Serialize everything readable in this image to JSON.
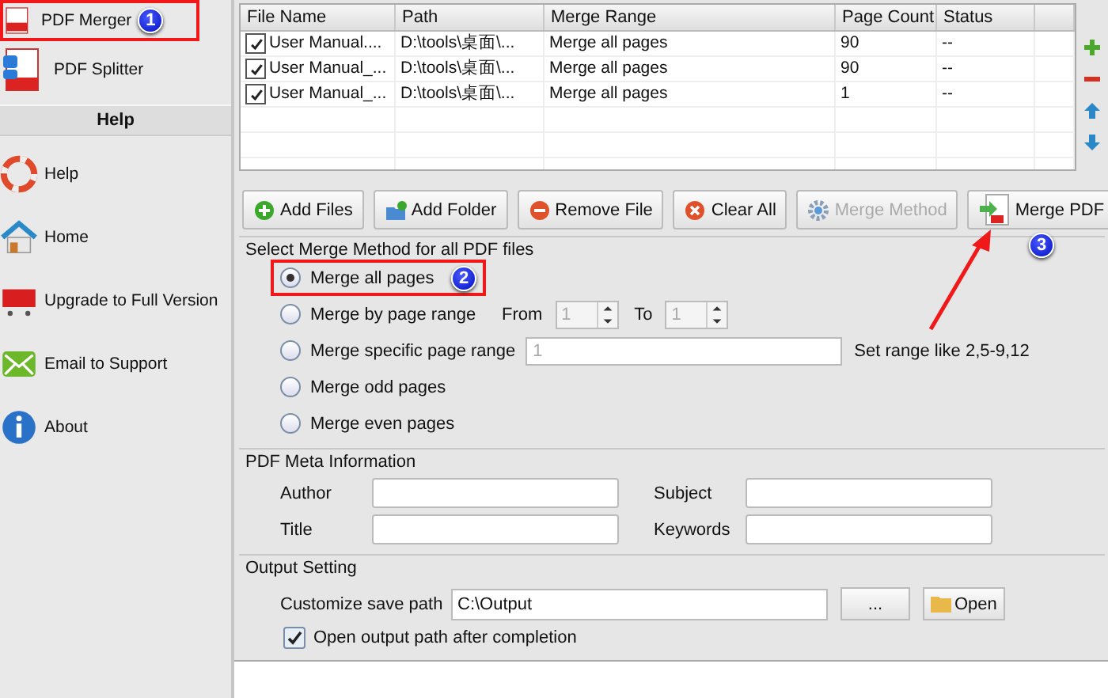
{
  "sidebar": {
    "tools": [
      {
        "label": "PDF Merger"
      },
      {
        "label": "PDF Splitter"
      }
    ],
    "help_heading": "Help",
    "help_items": [
      {
        "label": "Help"
      },
      {
        "label": "Home"
      },
      {
        "label": "Upgrade to Full Version"
      },
      {
        "label": "Email to Support"
      },
      {
        "label": "About"
      }
    ]
  },
  "file_table": {
    "columns": [
      "File Name",
      "Path",
      "Merge Range",
      "Page Count",
      "Status"
    ],
    "rows": [
      {
        "checked": true,
        "file_name": "User Manual....",
        "path": "D:\\tools\\桌面\\...",
        "merge_range": "Merge all pages",
        "page_count": "90",
        "status": "--"
      },
      {
        "checked": true,
        "file_name": "User Manual_...",
        "path": "D:\\tools\\桌面\\...",
        "merge_range": "Merge all pages",
        "page_count": "90",
        "status": "--"
      },
      {
        "checked": true,
        "file_name": "User Manual_...",
        "path": "D:\\tools\\桌面\\...",
        "merge_range": "Merge all pages",
        "page_count": "1",
        "status": "--"
      }
    ]
  },
  "toolbar": {
    "buttons": [
      {
        "label": "Add Files",
        "kind": "add",
        "disabled": false
      },
      {
        "label": "Add Folder",
        "kind": "folder",
        "disabled": false
      },
      {
        "label": "Remove File",
        "kind": "remove",
        "disabled": false
      },
      {
        "label": "Clear All",
        "kind": "clear",
        "disabled": false
      },
      {
        "label": "Merge Method",
        "kind": "gear",
        "disabled": true
      }
    ],
    "merge_button": "Merge PDF"
  },
  "merge_method": {
    "title": "Select Merge Method for all PDF files",
    "options": [
      {
        "label": "Merge all pages",
        "selected": true,
        "kind": "plain"
      },
      {
        "label": "Merge by page range",
        "selected": false,
        "kind": "range"
      },
      {
        "label": "Merge specific page range",
        "selected": false,
        "kind": "specific"
      },
      {
        "label": "Merge odd pages",
        "selected": false,
        "kind": "plain"
      },
      {
        "label": "Merge even pages",
        "selected": false,
        "kind": "plain"
      }
    ],
    "from_label": "From",
    "from_value": "1",
    "to_label": "To",
    "to_value": "1",
    "specific_value": "1",
    "specific_hint": "Set range like 2,5-9,12"
  },
  "meta": {
    "title": "PDF Meta Information",
    "fields": [
      {
        "label": "Author"
      },
      {
        "label": "Subject"
      },
      {
        "label": "Title"
      },
      {
        "label": "Keywords"
      }
    ]
  },
  "output": {
    "title": "Output Setting",
    "save_path_label": "Customize save path",
    "save_path": "C:\\Output",
    "browse_button": "...",
    "open_button": "Open",
    "open_after": {
      "label": "Open output path after completion",
      "checked": true
    }
  },
  "annotations": [
    {
      "number": "1"
    },
    {
      "number": "2"
    },
    {
      "number": "3"
    }
  ]
}
